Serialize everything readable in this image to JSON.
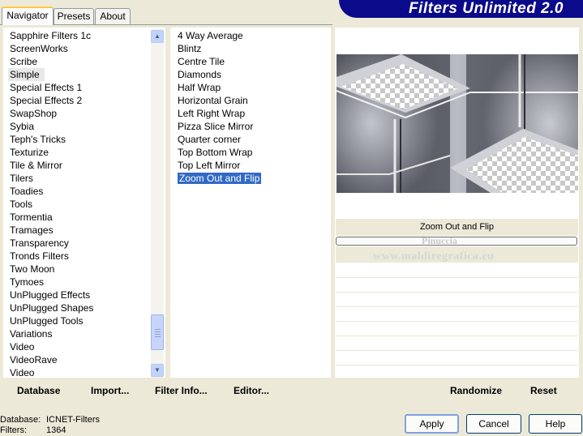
{
  "tabs": [
    "Navigator",
    "Presets",
    "About"
  ],
  "app_title": "Filters Unlimited 2.0",
  "categories": [
    "Sapphire Filters 1c",
    "ScreenWorks",
    "Scribe",
    "Simple",
    "Special Effects 1",
    "Special Effects 2",
    "SwapShop",
    "Sybia",
    "Teph's Tricks",
    "Texturize",
    "Tile & Mirror",
    "Tilers",
    "Toadies",
    "Tools",
    "Tormentia",
    "Tramages",
    "Transparency",
    "Tronds Filters",
    "Two Moon",
    "Tymoes",
    "UnPlugged Effects",
    "UnPlugged Shapes",
    "UnPlugged Tools",
    "Variations",
    "Video",
    "VideoRave",
    "Video"
  ],
  "selected_category": "Simple",
  "filters": [
    "4 Way Average",
    "Blintz",
    "Centre Tile",
    "Diamonds",
    "Half Wrap",
    "Horizontal Grain",
    "Left Right Wrap",
    "Pizza Slice Mirror",
    "Quarter corner",
    "Top Bottom Wrap",
    "Top Left Mirror",
    "Zoom Out and Flip"
  ],
  "selected_filter": "Zoom Out and Flip",
  "preview_filter_name": "Zoom Out and Flip",
  "watermark": {
    "line1": "Pinuccia",
    "line2": "www.maldiregrafica.eu"
  },
  "toolbar": {
    "database": "Database",
    "import": "Import...",
    "filter_info": "Filter Info...",
    "editor": "Editor...",
    "randomize": "Randomize",
    "reset": "Reset"
  },
  "status": {
    "database_label": "Database:",
    "database_value": "ICNET-Filters",
    "filters_label": "Filters:",
    "filters_value": "1364"
  },
  "buttons": {
    "apply": "Apply",
    "cancel": "Cancel",
    "help": "Help"
  },
  "colors": {
    "banner": "#0a0a8a",
    "selection": "#316ac5",
    "dialog_bg": "#ece9d8"
  }
}
